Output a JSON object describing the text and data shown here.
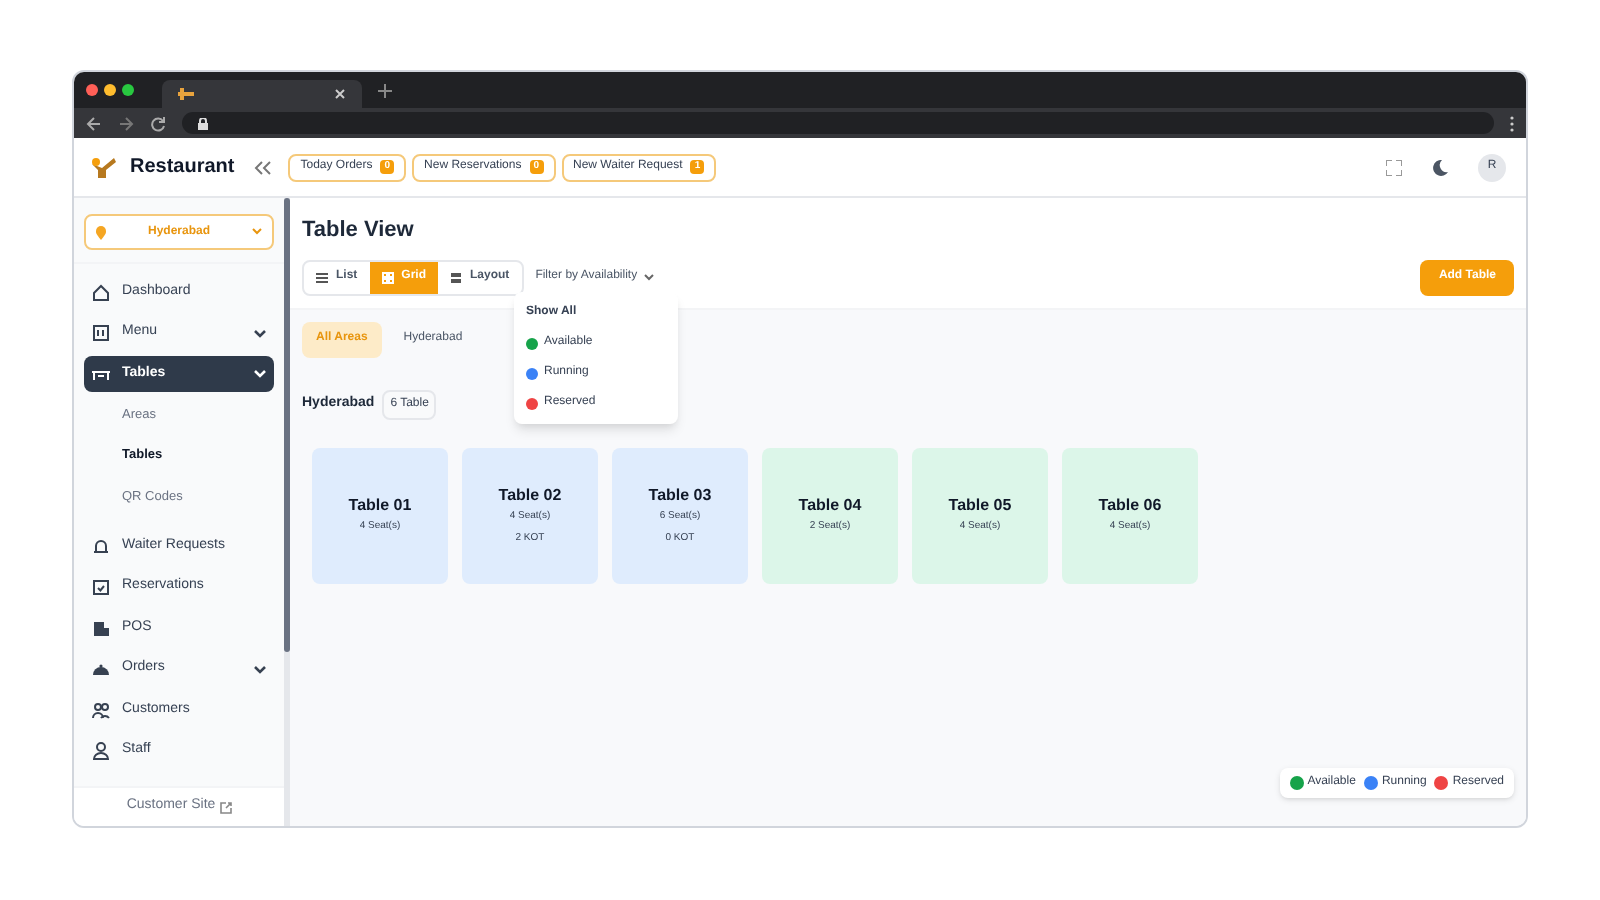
{
  "header": {
    "brand": "Restaurant",
    "counters": [
      {
        "label": "Today Orders",
        "count": "0"
      },
      {
        "label": "New Reservations",
        "count": "0"
      },
      {
        "label": "New Waiter Request",
        "count": "1"
      }
    ],
    "avatar": "R"
  },
  "sidebar": {
    "location": "Hyderabad",
    "items": [
      {
        "label": "Dashboard",
        "selected": false
      },
      {
        "label": "Menu",
        "selected": false,
        "has_submenu": true
      },
      {
        "label": "Tables",
        "selected": true,
        "has_submenu": true,
        "children": [
          {
            "label": "Areas",
            "selected": false
          },
          {
            "label": "Tables",
            "selected": true
          },
          {
            "label": "QR Codes",
            "selected": false
          }
        ]
      },
      {
        "label": "Waiter Requests",
        "selected": false
      },
      {
        "label": "Reservations",
        "selected": false
      },
      {
        "label": "POS",
        "selected": false
      },
      {
        "label": "Orders",
        "selected": false,
        "has_submenu": true
      },
      {
        "label": "Customers",
        "selected": false
      },
      {
        "label": "Staff",
        "selected": false
      }
    ],
    "footer": "Customer Site"
  },
  "page": {
    "title": "Table View",
    "views": [
      {
        "label": "List",
        "selected": false
      },
      {
        "label": "Grid",
        "selected": true
      },
      {
        "label": "Layout",
        "selected": false
      }
    ],
    "filter": "Filter by Availability",
    "add_button": "Add Table",
    "filter_menu": [
      {
        "label": "Show All"
      },
      {
        "label": "Available",
        "color": "#16a34a"
      },
      {
        "label": "Running",
        "color": "#3b82f6"
      },
      {
        "label": "Reserved",
        "color": "#ef4444"
      }
    ],
    "areas": [
      {
        "label": "All Areas",
        "selected": true
      },
      {
        "label": "Hyderabad",
        "selected": false
      }
    ],
    "section": {
      "title": "Hyderabad",
      "count": "6 Table"
    },
    "tables": [
      {
        "name": "Table 01",
        "seats": "4 Seat(s)",
        "color": "#dfecfd"
      },
      {
        "name": "Table 02",
        "seats": "4 Seat(s)",
        "kot": "2 KOT",
        "color": "#dfecfd"
      },
      {
        "name": "Table 03",
        "seats": "6 Seat(s)",
        "kot": "0 KOT",
        "color": "#dfecfd"
      },
      {
        "name": "Table 04",
        "seats": "2 Seat(s)",
        "color": "#dcf6e9"
      },
      {
        "name": "Table 05",
        "seats": "4 Seat(s)",
        "color": "#dcf6e9"
      },
      {
        "name": "Table 06",
        "seats": "4 Seat(s)",
        "color": "#dcf6e9"
      }
    ],
    "legend": [
      {
        "label": "Available",
        "color": "#16a34a"
      },
      {
        "label": "Running",
        "color": "#3b82f6"
      },
      {
        "label": "Reserved",
        "color": "#ef4444"
      }
    ]
  }
}
